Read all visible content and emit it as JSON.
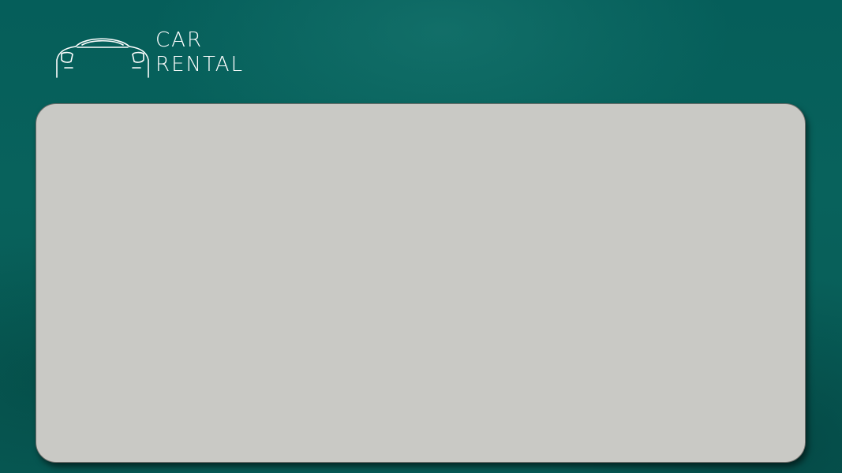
{
  "brand": {
    "line1": "CAR",
    "line2": "RENTAL",
    "icon": "car-outline-icon"
  },
  "colors": {
    "background": "#07605a",
    "panel": "#c9c9c5",
    "logo": "#ffffff"
  }
}
